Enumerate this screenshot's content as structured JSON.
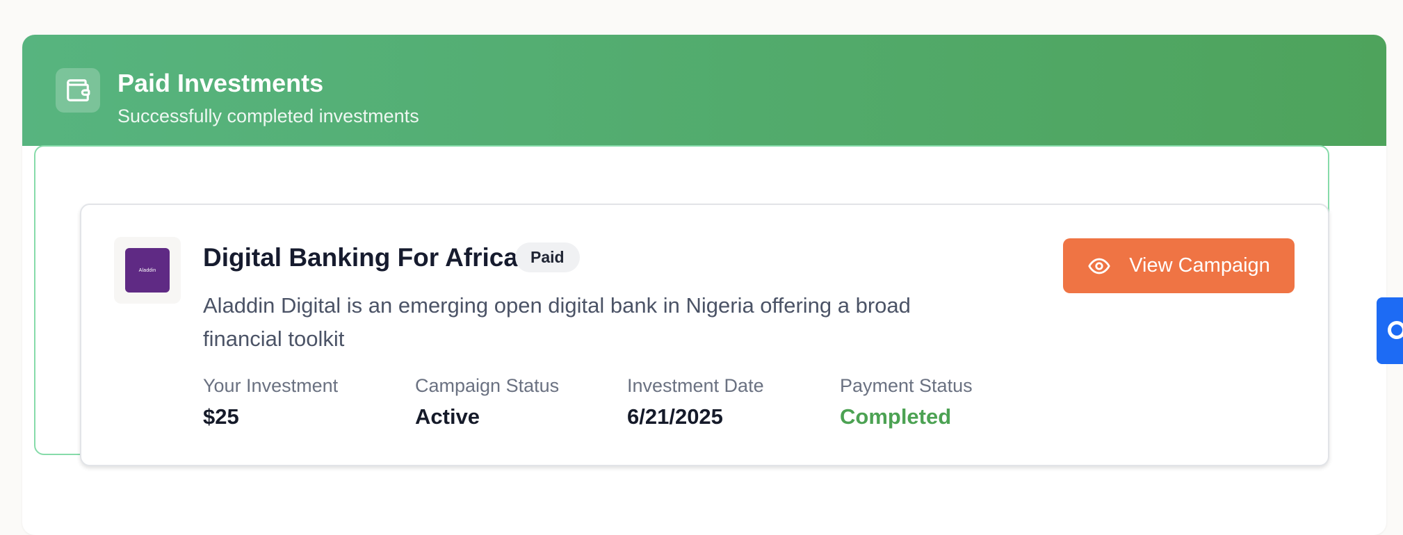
{
  "section": {
    "title": "Paid Investments",
    "subtitle": "Successfully completed investments",
    "icon": "wallet-icon",
    "accent_color": "#4fa862"
  },
  "investment": {
    "logo_text": "Aladdin",
    "title": "Digital Banking For Africa",
    "badge": "Paid",
    "description": "Aladdin Digital is an emerging open digital bank in Nigeria offering a broad financial toolkit",
    "stats": [
      {
        "label": "Your Investment",
        "value": "$25"
      },
      {
        "label": "Campaign Status",
        "value": "Active"
      },
      {
        "label": "Investment Date",
        "value": "6/21/2025"
      },
      {
        "label": "Payment Status",
        "value": "Completed",
        "color": "#4ca253"
      }
    ],
    "action": {
      "label": "View Campaign",
      "icon": "eye-icon",
      "color": "#ef7444"
    }
  },
  "side_widget": {
    "icon": "chat-icon",
    "color": "#1d6bf4"
  }
}
